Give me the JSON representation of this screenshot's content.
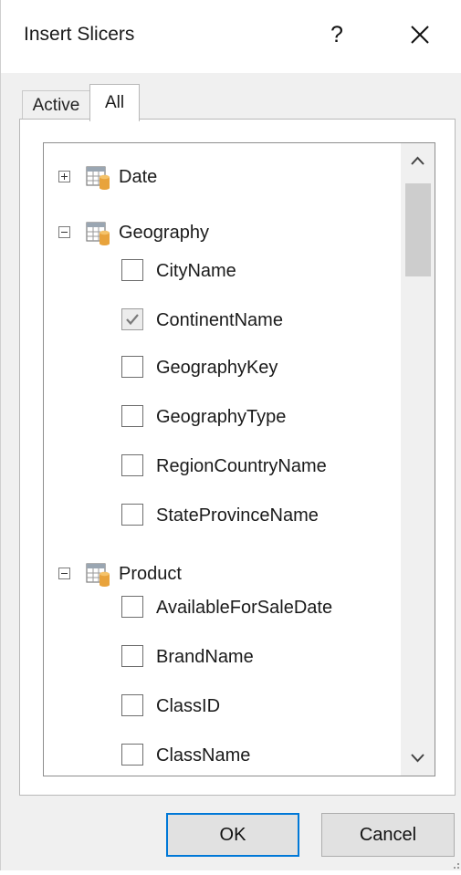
{
  "dialog": {
    "title": "Insert Slicers",
    "help_label": "?",
    "close_icon": "close-icon"
  },
  "tabs": [
    {
      "label": "Active",
      "selected": false
    },
    {
      "label": "All",
      "selected": true
    }
  ],
  "tree": {
    "tables": [
      {
        "name": "Date",
        "expanded": false,
        "fields": []
      },
      {
        "name": "Geography",
        "expanded": true,
        "fields": [
          {
            "name": "CityName",
            "checked": false
          },
          {
            "name": "ContinentName",
            "checked": true
          },
          {
            "name": "GeographyKey",
            "checked": false
          },
          {
            "name": "GeographyType",
            "checked": false
          },
          {
            "name": "RegionCountryName",
            "checked": false
          },
          {
            "name": "StateProvinceName",
            "checked": false
          }
        ]
      },
      {
        "name": "Product",
        "expanded": true,
        "fields": [
          {
            "name": "AvailableForSaleDate",
            "checked": false
          },
          {
            "name": "BrandName",
            "checked": false
          },
          {
            "name": "ClassID",
            "checked": false
          },
          {
            "name": "ClassName",
            "checked": false
          }
        ]
      }
    ]
  },
  "buttons": {
    "ok": "OK",
    "cancel": "Cancel"
  },
  "colors": {
    "accent": "#0078d7",
    "table_icon_cylinder": "#e8a33c"
  }
}
